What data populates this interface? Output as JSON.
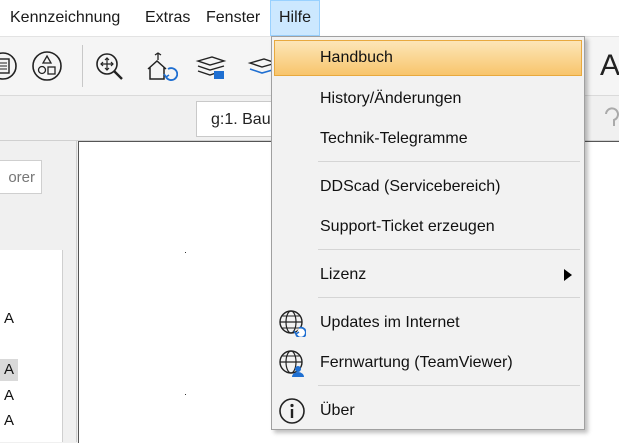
{
  "menubar": {
    "items": [
      "Kennzeichnung",
      "Extras",
      "Fenster",
      "Hilfe"
    ]
  },
  "layer": {
    "value": "g:1. Bau"
  },
  "left_panel": {
    "tab_label": "orer",
    "tree_items": [
      "A",
      "A",
      "A",
      "A"
    ]
  },
  "toolbar_right_glyph": "A",
  "help_menu": {
    "items": [
      {
        "label": "Handbuch"
      },
      {
        "label": "History/Änderungen"
      },
      {
        "label": "Technik-Telegramme"
      },
      {
        "label": "DDScad (Servicebereich)"
      },
      {
        "label": "Support-Ticket erzeugen"
      },
      {
        "label": "Lizenz"
      },
      {
        "label": "Updates im Internet"
      },
      {
        "label": "Fernwartung (TeamViewer)"
      },
      {
        "label": "Über"
      }
    ]
  },
  "colors": {
    "menu_active_bg": "#cce8ff",
    "highlight_top": "#fce6b8",
    "highlight_bottom": "#f8c56c",
    "icon_blue": "#1f6fd1"
  }
}
